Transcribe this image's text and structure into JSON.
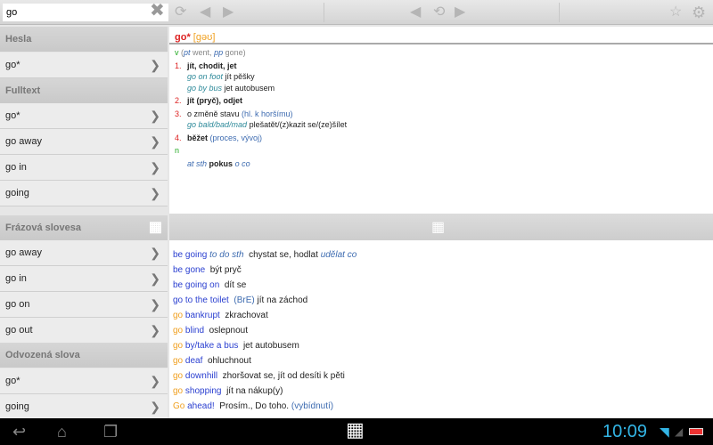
{
  "toolbar": {
    "search_value": "go"
  },
  "left": {
    "sections": [
      {
        "title": "Hesla",
        "items": [
          "go*"
        ]
      },
      {
        "title": "Fulltext",
        "items": [
          "go*",
          "go away",
          "go in",
          "going"
        ]
      },
      {
        "title": "Frázová slovesa",
        "items": [
          "go away",
          "go in",
          "go on",
          "go out"
        ]
      },
      {
        "title": "Odvozená slova",
        "items": [
          "go*",
          "going"
        ]
      }
    ]
  },
  "entry": {
    "headword": "go*",
    "pron": "[gəʊ]",
    "pos_v": "v",
    "pt": "pt",
    "went": "went,",
    "pp": "pp",
    "gone": "gone",
    "senses": [
      {
        "num": "1.",
        "text": "jít, chodit, jet",
        "ex": [
          [
            "go on foot",
            "jít pěšky"
          ],
          [
            "go by bus",
            "jet autobusem"
          ]
        ]
      },
      {
        "num": "2.",
        "text": "jít (pryč), odjet"
      },
      {
        "num": "3.",
        "text": "o změně stavu",
        "note": "(hl. k horšímu)",
        "ex": [
          [
            "go bald/bad/mad",
            "plešatět/(z)kazit se/(ze)šílet"
          ]
        ]
      },
      {
        "num": "4.",
        "text": "běžet",
        "note": "(proces, vývoj)"
      }
    ],
    "pos_n": "n",
    "n_ex1": "at sth",
    "n_tr": "pokus",
    "n_ex2": "o co"
  },
  "phrases": [
    {
      "a": "",
      "b": "be going",
      "c": "to do sth",
      "t": "chystat se, hodlat",
      "d": "udělat co"
    },
    {
      "a": "",
      "b": "be gone",
      "c": "",
      "t": "být pryč",
      "d": ""
    },
    {
      "a": "",
      "b": "be going on",
      "c": "",
      "t": "dít se",
      "d": ""
    },
    {
      "a": "",
      "b": "go to the toilet",
      "c": "",
      "t": "jít na záchod",
      "n": "(BrE)"
    },
    {
      "a": "go",
      "b": "bankrupt",
      "t": "zkrachovat"
    },
    {
      "a": "go",
      "b": "blind",
      "t": "oslepnout"
    },
    {
      "a": "go",
      "b": "by/take a bus",
      "t": "jet autobusem"
    },
    {
      "a": "go",
      "b": "deaf",
      "t": "ohluchnout"
    },
    {
      "a": "go",
      "b": "downhill",
      "t": "zhoršovat se, jít od desíti k pěti"
    },
    {
      "a": "go",
      "b": "shopping",
      "t": "jít na nákup(y)"
    },
    {
      "a": "Go",
      "b": "ahead!",
      "t": "Prosím., Do toho.",
      "d2": "(vybídnutí)"
    }
  ],
  "status": {
    "time": "10:09"
  }
}
